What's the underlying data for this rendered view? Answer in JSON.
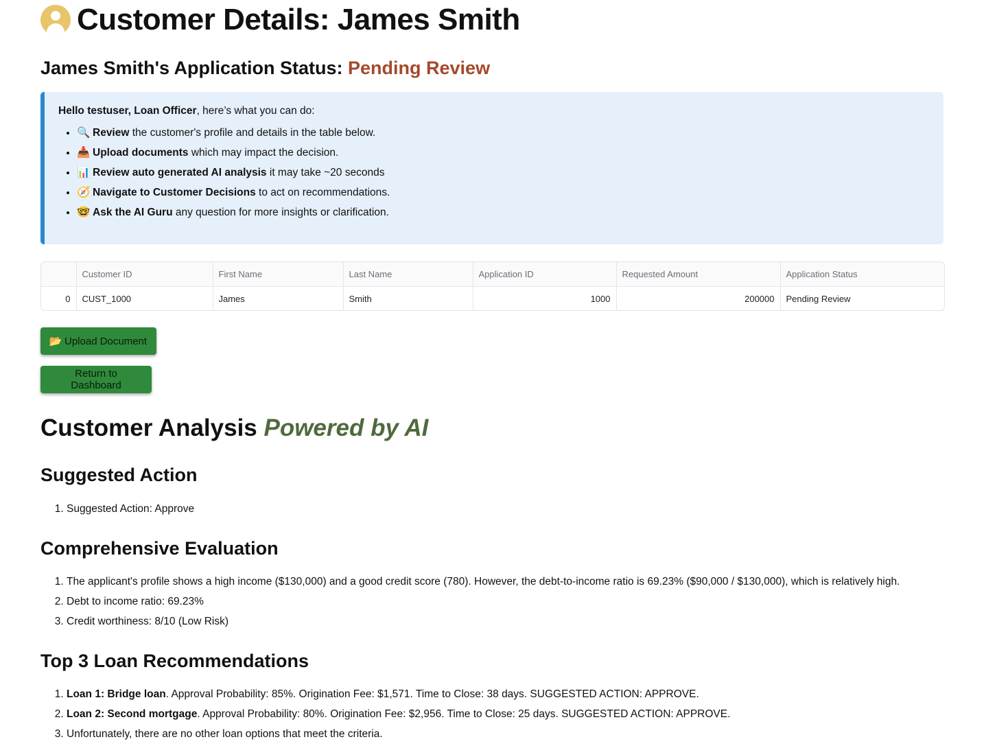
{
  "header": {
    "title": "Customer Details: James Smith",
    "icon": "user-avatar-icon"
  },
  "status": {
    "prefix": "James Smith's Application Status: ",
    "value": "Pending Review",
    "value_color": "#a5492b"
  },
  "info": {
    "greeting_bold": "Hello testuser, Loan Officer",
    "greeting_rest": ", here’s what you can do:",
    "items": [
      {
        "icon": "🔍",
        "bold": "Review",
        "rest": " the customer's profile and details in the table below."
      },
      {
        "icon": "📥",
        "bold": "Upload documents",
        "rest": " which may impact the decision."
      },
      {
        "icon": "📊",
        "bold": "Review auto generated AI analysis",
        "rest": " it may take ~20 seconds"
      },
      {
        "icon": "🧭",
        "bold": "Navigate to Customer Decisions",
        "rest": " to act on recommendations."
      },
      {
        "icon": "🤓",
        "bold": "Ask the AI Guru",
        "rest": " any question for more insights or clarification."
      }
    ]
  },
  "table": {
    "columns": [
      "",
      "Customer ID",
      "First Name",
      "Last Name",
      "Application ID",
      "Requested Amount",
      "Application Status"
    ],
    "rows": [
      [
        "0",
        "CUST_1000",
        "James",
        "Smith",
        "1000",
        "200000",
        "Pending Review"
      ]
    ]
  },
  "buttons": {
    "upload_icon": "📂",
    "upload_label": "Upload Document",
    "return_label": "Return to Dashboard",
    "color": "#2f8a3b"
  },
  "analysis": {
    "title": "Customer Analysis ",
    "powered": "Powered by AI",
    "powered_color": "#4f6a3c",
    "suggested_title": "Suggested Action",
    "suggested_items": [
      "Suggested Action: Approve"
    ],
    "evaluation_title": "Comprehensive Evaluation",
    "evaluation_items": [
      "The applicant's profile shows a high income ($130,000) and a good credit score (780). However, the debt-to-income ratio is 69.23% ($90,000 / $130,000), which is relatively high.",
      "Debt to income ratio: 69.23%",
      "Credit worthiness: 8/10 (Low Risk)"
    ],
    "recommendations_title": "Top 3 Loan Recommendations",
    "recommendations": [
      {
        "bold": "Loan 1: Bridge loan",
        "rest": ". Approval Probability: 85%. Origination Fee: $1,571. Time to Close: 38 days. SUGGESTED ACTION: APPROVE."
      },
      {
        "bold": "Loan 2: Second mortgage",
        "rest": ". Approval Probability: 80%. Origination Fee: $2,956. Time to Close: 25 days. SUGGESTED ACTION: APPROVE."
      },
      {
        "bold": "",
        "rest": "Unfortunately, there are no other loan options that meet the criteria."
      }
    ]
  }
}
